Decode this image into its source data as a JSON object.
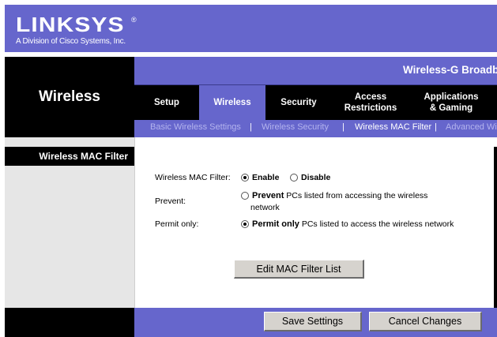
{
  "header": {
    "logo_text": "LINKSYS",
    "logo_reg": "®",
    "logo_subtitle": "A Division of Cisco Systems, Inc."
  },
  "product": {
    "name": "Wireless-G Broadb"
  },
  "section": {
    "title": "Wireless"
  },
  "tabs": [
    {
      "label": "Setup",
      "active": false
    },
    {
      "label": "Wireless",
      "active": true
    },
    {
      "label": "Security",
      "active": false
    },
    {
      "label": "Access Restrictions",
      "active": false
    },
    {
      "label": "Applications & Gaming",
      "active": false
    }
  ],
  "subtabs": {
    "items": [
      "Basic Wireless Settings",
      "Wireless Security",
      "Wireless MAC Filter",
      "Advanced Wi"
    ],
    "separator": "|",
    "active": "Wireless MAC Filter"
  },
  "left_label": "Wireless MAC Filter",
  "form": {
    "mac_filter": {
      "label": "Wireless MAC Filter:",
      "enable": "Enable",
      "disable": "Disable",
      "selected": "Enable"
    },
    "prevent": {
      "label": "Prevent:",
      "bold": "Prevent",
      "text_line1": " PCs listed from accessing the wireless",
      "text_line2": "network",
      "selected": false
    },
    "permit": {
      "label": "Permit only:",
      "bold": "Permit only",
      "text": " PCs listed to access the wireless network",
      "selected": true
    },
    "edit_button": "Edit MAC Filter List"
  },
  "footer": {
    "save": "Save Settings",
    "cancel": "Cancel Changes"
  },
  "colors": {
    "brand_blue": "#6666cc",
    "black": "#000000",
    "button_gray": "#d6d3ce"
  }
}
